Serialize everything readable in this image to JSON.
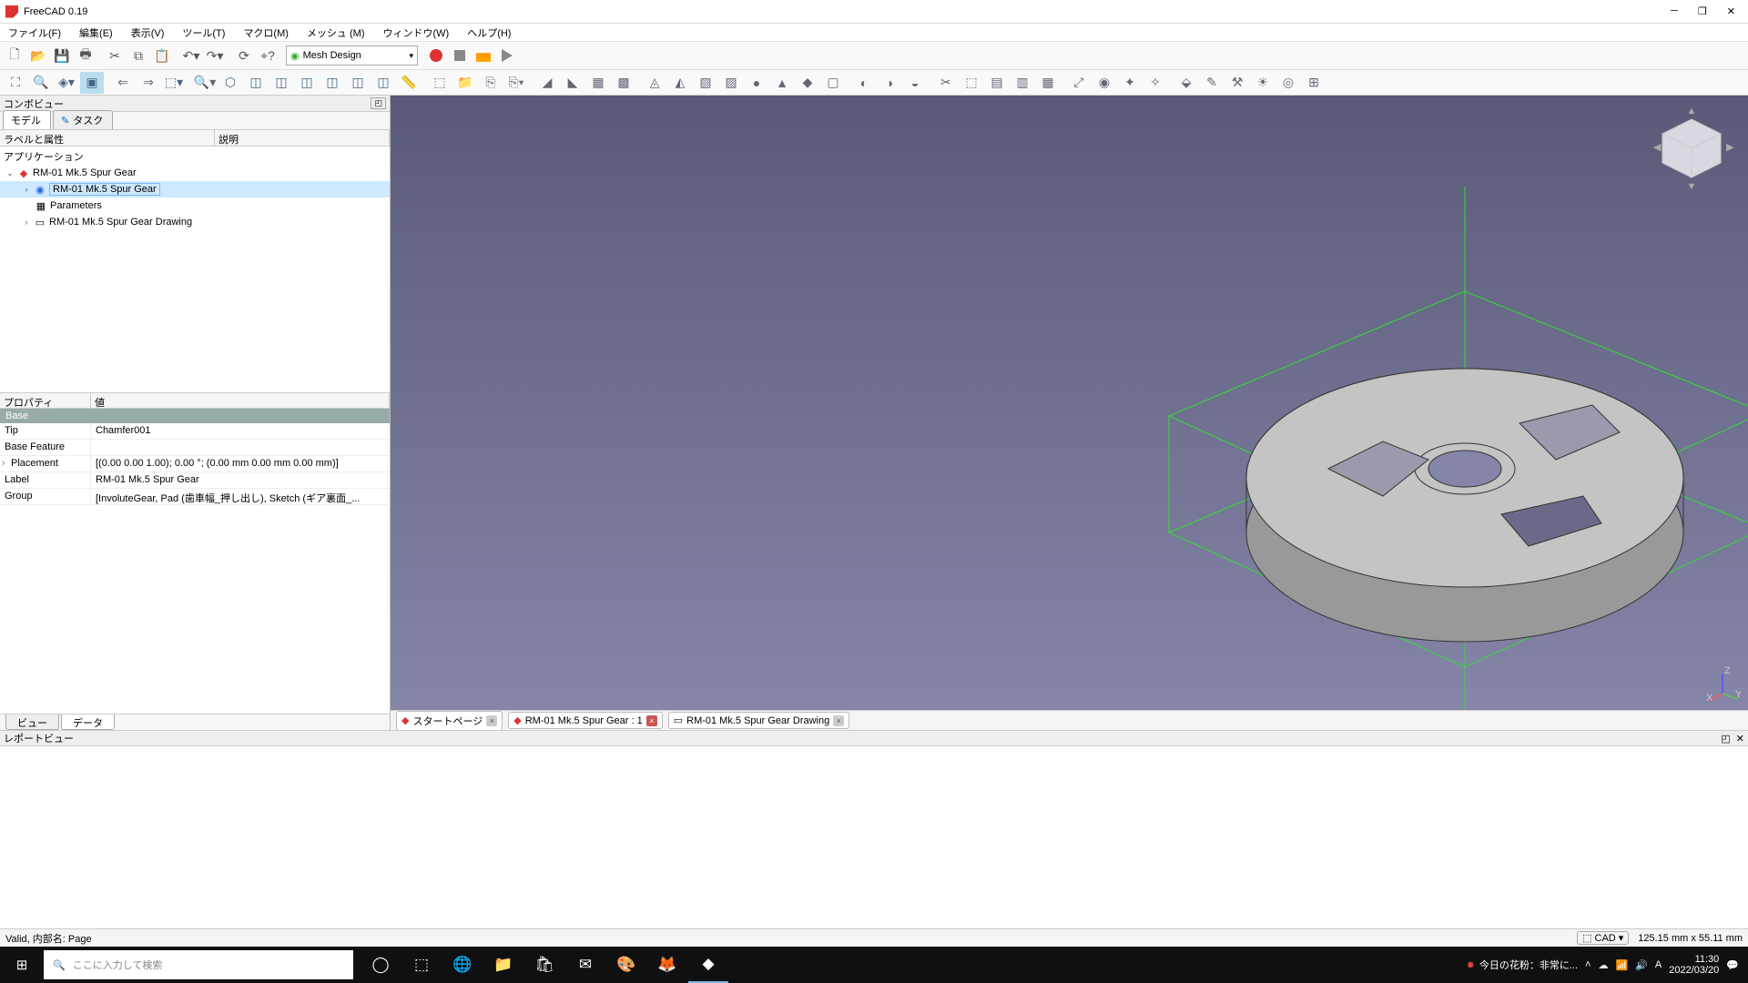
{
  "app_title": "FreeCAD 0.19",
  "menus": [
    "ファイル(F)",
    "編集(E)",
    "表示(V)",
    "ツール(T)",
    "マクロ(M)",
    "メッシュ (M)",
    "ウィンドウ(W)",
    "ヘルプ(H)"
  ],
  "workbench": "Mesh Design",
  "combo_title": "コンボビュー",
  "combo_tabs": {
    "model": "モデル",
    "task": "タスク"
  },
  "tree_header": {
    "label": "ラベルと属性",
    "desc": "説明"
  },
  "tree": {
    "app": "アプリケーション",
    "doc": "RM-01 Mk.5 Spur Gear",
    "body": "RM-01 Mk.5 Spur Gear",
    "params": "Parameters",
    "drawing": "RM-01 Mk.5 Spur Gear Drawing"
  },
  "prop_header": {
    "prop": "プロパティ",
    "val": "値"
  },
  "prop_group": "Base",
  "props": [
    {
      "k": "Tip",
      "v": "Chamfer001"
    },
    {
      "k": "Base Feature",
      "v": ""
    },
    {
      "k": "Placement",
      "v": "[(0.00 0.00 1.00); 0.00 °; (0.00 mm  0.00 mm  0.00 mm)]"
    },
    {
      "k": "Label",
      "v": "RM-01 Mk.5 Spur Gear"
    },
    {
      "k": "Group",
      "v": "[InvoluteGear, Pad (歯車幅_押し出し), Sketch (ギア裏面_..."
    }
  ],
  "prop_tabs": {
    "view": "ビュー",
    "data": "データ"
  },
  "doc_tabs": [
    {
      "label": "スタートページ",
      "active": false
    },
    {
      "label": "RM-01 Mk.5 Spur Gear : 1",
      "active": true
    },
    {
      "label": "RM-01 Mk.5 Spur Gear Drawing",
      "active": false
    }
  ],
  "report_title": "レポートビュー",
  "status_left": "Valid, 内部名: Page",
  "status_cad": "CAD",
  "status_dims": "125.15 mm x 55.11 mm",
  "taskbar": {
    "search_placeholder": "ここに入力して検索",
    "weather": "今日の花粉：非常に...",
    "time": "11:30",
    "date": "2022/03/20"
  }
}
